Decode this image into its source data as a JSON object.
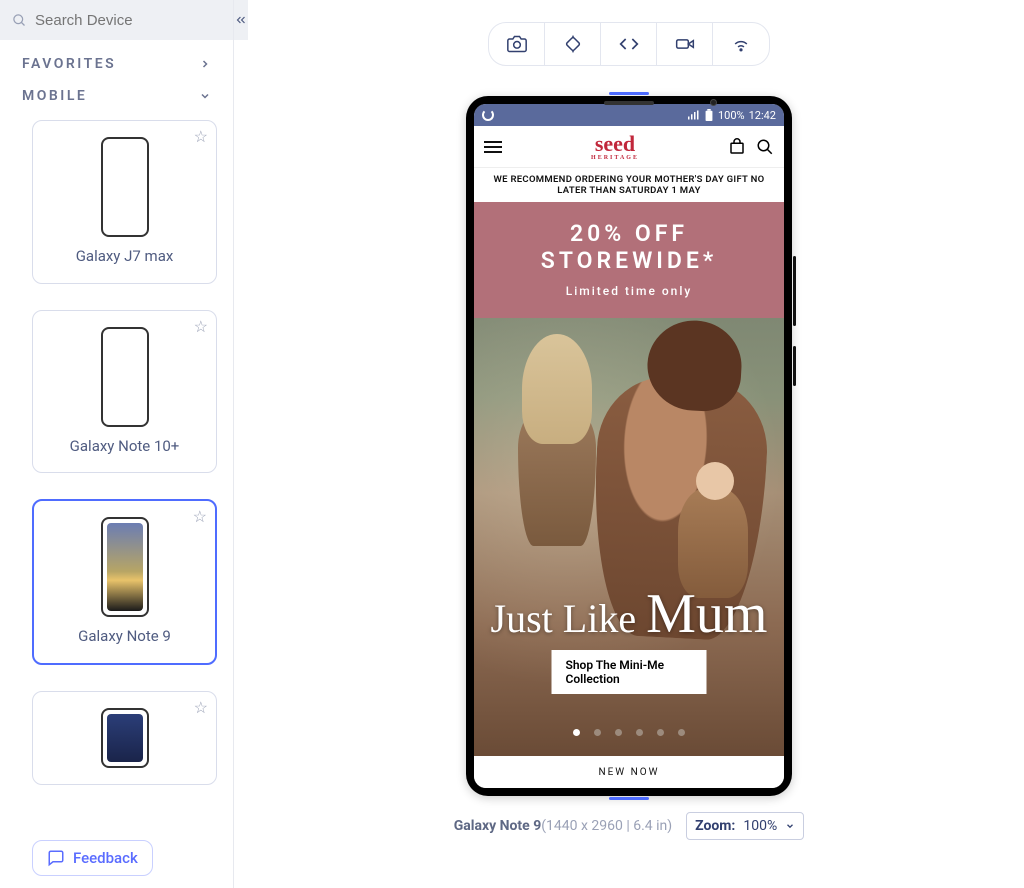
{
  "sidebar": {
    "search_placeholder": "Search Device",
    "favorites_label": "FAVORITES",
    "mobile_label": "MOBILE",
    "feedback_label": "Feedback",
    "devices": [
      {
        "label": "Galaxy J7 max",
        "selected": false
      },
      {
        "label": "Galaxy Note 10+",
        "selected": false
      },
      {
        "label": "Galaxy Note 9",
        "selected": true
      },
      {
        "label": "",
        "selected": false
      }
    ]
  },
  "toolbar": {
    "icons": [
      "camera-icon",
      "rotate-icon",
      "code-icon",
      "video-icon",
      "wifi-icon"
    ]
  },
  "device_preview": {
    "status": {
      "battery_pct": "100%",
      "time": "12:42"
    },
    "brand": "seed",
    "brand_sub": "HERITAGE",
    "recommend": "WE RECOMMEND ORDERING YOUR MOTHER'S DAY GIFT NO LATER THAN SATURDAY 1 MAY",
    "promo": {
      "line1": "20% OFF",
      "line2": "STOREWIDE*",
      "sub": "Limited time only"
    },
    "hero": {
      "script1": "Just Like",
      "script2": "Mum",
      "cta": "Shop The Mini-Me Collection"
    },
    "footer_teaser": "NEW NOW"
  },
  "meta": {
    "device_name": "Galaxy Note 9",
    "dimensions": "(1440 x 2960 | 6.4 in)",
    "zoom_label": "Zoom:",
    "zoom_value": "100%"
  }
}
